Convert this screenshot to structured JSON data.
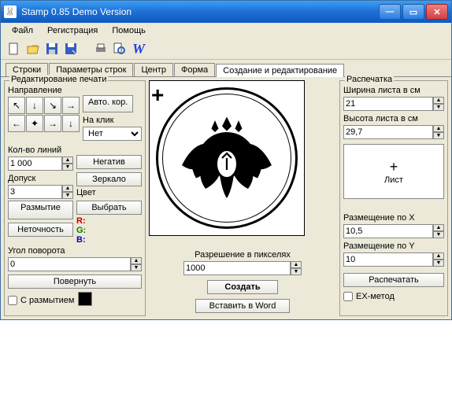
{
  "window": {
    "title": "Stamp 0.85 Demo Version"
  },
  "menu": {
    "file": "Файл",
    "reg": "Регистрация",
    "help": "Помощь"
  },
  "toolbar": {
    "w": "W"
  },
  "tabs": {
    "t0": "Строки",
    "t1": "Параметры строк",
    "t2": "Центр",
    "t3": "Форма",
    "t4": "Создание и редактирование"
  },
  "edit": {
    "group": "Редактирование печати",
    "direction": "Направление",
    "autocorr": "Авто. кор.",
    "onclick": "На клик",
    "onclick_sel": "Нет",
    "lines": "Кол-во линий",
    "lines_val": "1 000",
    "negative": "Негатив",
    "tolerance": "Допуск",
    "tolerance_val": "3",
    "mirror": "Зеркало",
    "color": "Цвет",
    "blur": "Размытие",
    "select": "Выбрать",
    "inaccuracy": "Неточность",
    "r": "R:",
    "g": "G:",
    "b": "B:",
    "angle": "Угол поворота",
    "angle_val": "0",
    "rotate": "Повернуть",
    "with_blur": "С размытием"
  },
  "create": {
    "resolution_label": "Разрешение в пикселях",
    "resolution_val": "1000",
    "create_btn": "Создать",
    "insert_btn": "Вставить в Word"
  },
  "print": {
    "group": "Распечатка",
    "sheet_w": "Ширина листа в см",
    "sheet_w_val": "21",
    "sheet_h": "Высота листа в см",
    "sheet_h_val": "29,7",
    "sheet_btn_plus": "+",
    "sheet_btn": "Лист",
    "pos_x": "Размещение по X",
    "pos_x_val": "10,5",
    "pos_y": "Размещение по Y",
    "pos_y_val": "10",
    "print_btn": "Распечатать",
    "ex_method": "EX-метод"
  }
}
